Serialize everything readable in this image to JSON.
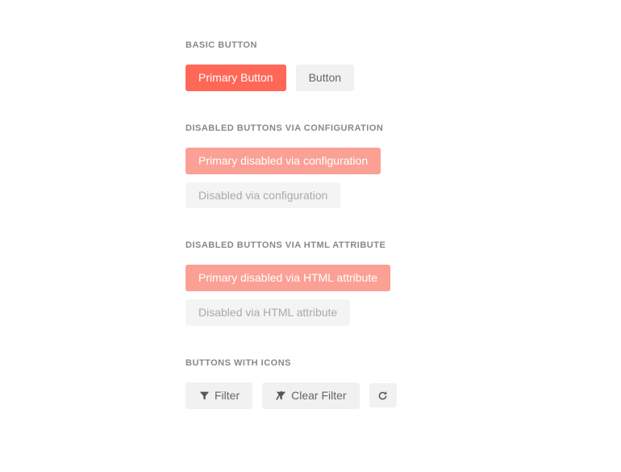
{
  "sections": {
    "basic": {
      "title": "BASIC BUTTON",
      "primary_label": "Primary Button",
      "default_label": "Button"
    },
    "disabled_config": {
      "title": "DISABLED BUTTONS VIA CONFIGURATION",
      "primary_label": "Primary disabled via configuration",
      "default_label": "Disabled via configuration"
    },
    "disabled_attr": {
      "title": "DISABLED BUTTONS VIA HTML ATTRIBUTE",
      "primary_label": "Primary disabled via HTML attribute",
      "default_label": "Disabled via HTML attribute"
    },
    "icons": {
      "title": "BUTTONS WITH ICONS",
      "filter_label": "Filter",
      "clear_filter_label": "Clear Filter"
    }
  }
}
